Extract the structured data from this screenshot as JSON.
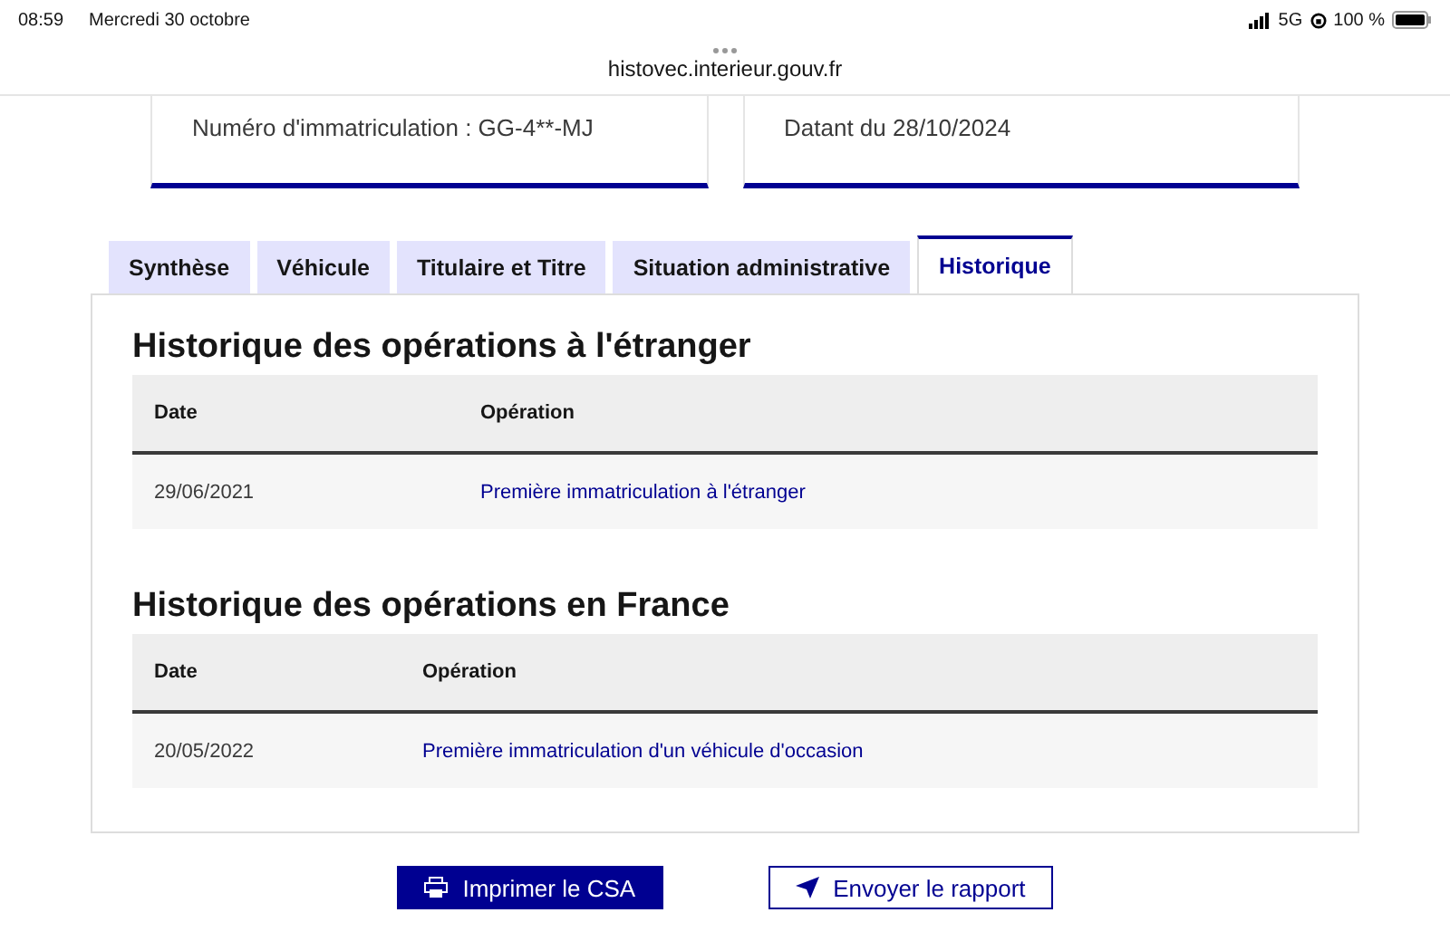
{
  "status_bar": {
    "time": "08:59",
    "date": "Mercredi 30 octobre",
    "network": "5G",
    "battery": "100 %"
  },
  "url": "histovec.interieur.gouv.fr",
  "cards": [
    {
      "text": "Numéro d'immatriculation : GG-4**-MJ"
    },
    {
      "text": "Datant du 28/10/2024"
    }
  ],
  "tabs": [
    {
      "label": "Synthèse",
      "selected": false
    },
    {
      "label": "Véhicule",
      "selected": false
    },
    {
      "label": "Titulaire et Titre",
      "selected": false
    },
    {
      "label": "Situation administrative",
      "selected": false
    },
    {
      "label": "Historique",
      "selected": true
    }
  ],
  "sections": [
    {
      "title": "Historique des opérations à l'étranger",
      "columns": [
        "Date",
        "Opération"
      ],
      "rows": [
        {
          "date": "29/06/2021",
          "operation": "Première immatriculation à l'étranger"
        }
      ]
    },
    {
      "title": "Historique des opérations en France",
      "columns": [
        "Date",
        "Opération"
      ],
      "rows": [
        {
          "date": "20/05/2022",
          "operation": "Première immatriculation d'un véhicule d'occasion"
        }
      ]
    }
  ],
  "buttons": [
    {
      "label": "Imprimer le CSA",
      "kind": "primary"
    },
    {
      "label": "Envoyer le rapport",
      "kind": "secondary"
    }
  ]
}
